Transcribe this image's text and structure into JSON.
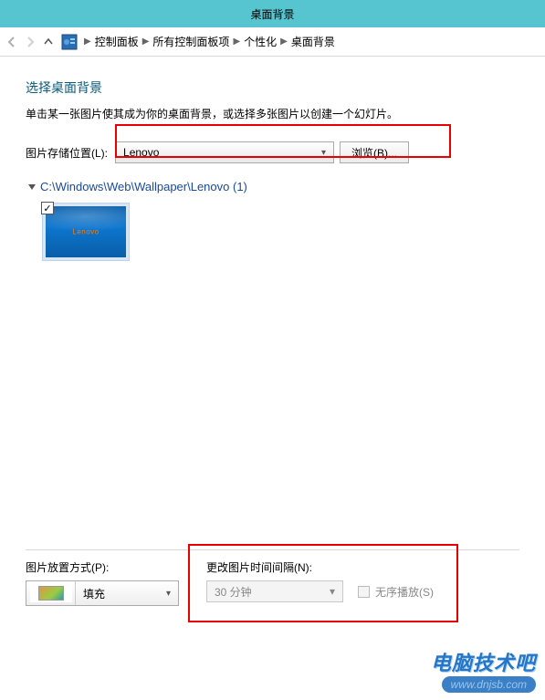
{
  "titlebar": {
    "title": "桌面背景"
  },
  "breadcrumb": {
    "items": [
      "控制面板",
      "所有控制面板项",
      "个性化",
      "桌面背景"
    ]
  },
  "heading": "选择桌面背景",
  "subtext": "单击某一张图片使其成为你的桌面背景，或选择多张图片以创建一个幻灯片。",
  "location": {
    "label": "图片存储位置(L):",
    "value": "Lenovo",
    "browse": "浏览(B)..."
  },
  "folder": {
    "path": "C:\\Windows\\Web\\Wallpaper\\Lenovo (1)",
    "thumb_checked": true,
    "thumb_brand": "Lenovo"
  },
  "placement": {
    "label": "图片放置方式(P):",
    "value": "填充"
  },
  "interval": {
    "label": "更改图片时间间隔(N):",
    "value": "30 分钟",
    "shuffle_label": "无序播放(S)"
  },
  "watermark": {
    "line1": "电脑技术吧",
    "line2": "www.dnjsb.com"
  }
}
